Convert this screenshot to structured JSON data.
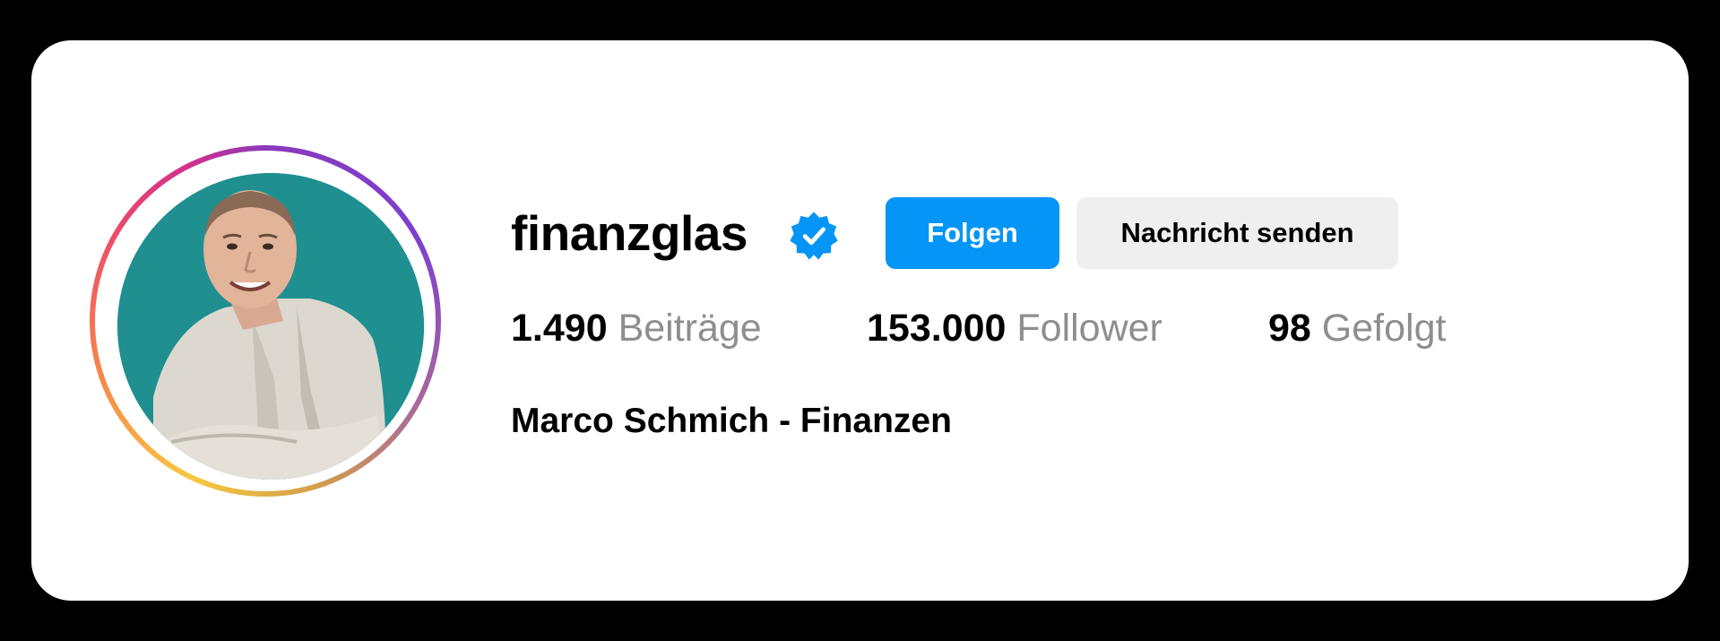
{
  "profile": {
    "username": "finanzglas",
    "verified": true,
    "full_name": "Marco Schmich - Finanzen"
  },
  "actions": {
    "follow_label": "Folgen",
    "message_label": "Nachricht senden"
  },
  "stats": {
    "posts": {
      "value": "1.490",
      "label": "Beiträge"
    },
    "followers": {
      "value": "153.000",
      "label": "Follower"
    },
    "following": {
      "value": "98",
      "label": "Gefolgt"
    }
  },
  "icons": {
    "verified_badge": "verified-badge-icon"
  },
  "colors": {
    "follow_button": "#0495f6",
    "message_button": "#efefef",
    "verified_badge": "#0495f6",
    "stat_label": "#8e8e8e",
    "avatar_background": "#1f8f90"
  }
}
